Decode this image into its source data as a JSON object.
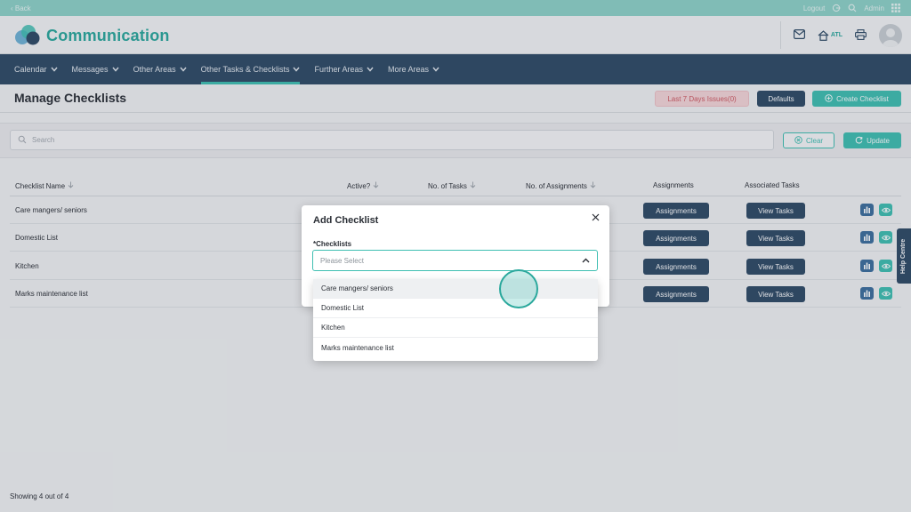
{
  "topbar": {
    "back": "‹ Back",
    "logout": "Logout",
    "user": "Admin"
  },
  "header": {
    "app_title": "Communication",
    "location": "ATL"
  },
  "nav": {
    "items": [
      {
        "label": "Calendar"
      },
      {
        "label": "Messages"
      },
      {
        "label": "Other Areas"
      },
      {
        "label": "Other Tasks & Checklists",
        "active": true
      },
      {
        "label": "Further Areas"
      },
      {
        "label": "More Areas"
      }
    ]
  },
  "page": {
    "title": "Manage Checklists",
    "issues_button": "Last 7 Days Issues(0)",
    "defaults_button": "Defaults",
    "create_button": "Create Checklist"
  },
  "search": {
    "placeholder": "Search",
    "clear_button": "Clear",
    "update_button": "Update"
  },
  "table": {
    "columns": [
      "Checklist Name",
      "Active?",
      "No. of Tasks",
      "No. of Assignments",
      "Assignments",
      "Associated Tasks"
    ],
    "rows": [
      {
        "name": "Care mangers/ seniors",
        "assign_button": "Assignments",
        "tasks_button": "View Tasks"
      },
      {
        "name": "Domestic List",
        "assign_button": "Assignments",
        "tasks_button": "View Tasks"
      },
      {
        "name": "Kitchen",
        "assign_button": "Assignments",
        "tasks_button": "View Tasks"
      },
      {
        "name": "Marks maintenance list",
        "assign_button": "Assignments",
        "tasks_button": "View Tasks"
      }
    ]
  },
  "footer": {
    "showing": "Showing 4 out of 4"
  },
  "help_tab": "Help Centre",
  "modal": {
    "title": "Add Checklist",
    "field_label": "*Checklists",
    "select_placeholder": "Please Select",
    "options": [
      "Care mangers/ seniors",
      "Domestic List",
      "Kitchen",
      "Marks maintenance list"
    ]
  },
  "colors": {
    "teal": "#3fbfb2",
    "navy": "#2f4b66",
    "danger": "#d05a63"
  }
}
